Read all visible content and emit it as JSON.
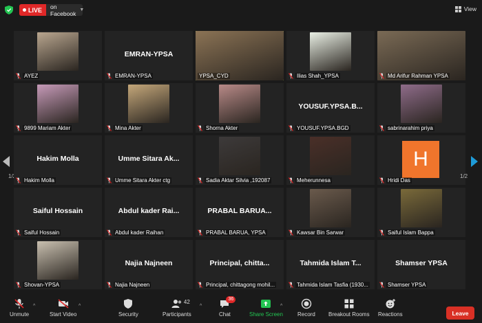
{
  "topbar": {
    "live_label": "LIVE",
    "live_destination": "on Facebook",
    "view_label": "View"
  },
  "gallery": {
    "page_indicator": "1/2",
    "tiles": [
      {
        "center": "",
        "label": "AYEZ",
        "muted": true,
        "kind": "video",
        "tone": "#b9a68f"
      },
      {
        "center": "EMRAN-YPSA",
        "label": "EMRAN-YPSA",
        "muted": true,
        "kind": "name"
      },
      {
        "center": "",
        "label": "YPSA_CYD",
        "muted": false,
        "kind": "wide",
        "tone": "#8b7355",
        "active": true
      },
      {
        "center": "",
        "label": "Ilias Shah_YPSA",
        "muted": true,
        "kind": "video",
        "tone": "#e9efe4"
      },
      {
        "center": "",
        "label": "Md Arifur Rahman YPSA",
        "muted": true,
        "kind": "wide",
        "tone": "#7a6a55"
      },
      {
        "center": "",
        "label": "9899 Mariam Akter",
        "muted": true,
        "kind": "video",
        "tone": "#c69ab8"
      },
      {
        "center": "",
        "label": "Mina Akter",
        "muted": true,
        "kind": "video",
        "tone": "#c4a77a"
      },
      {
        "center": "",
        "label": "Shorna Akter",
        "muted": true,
        "kind": "video",
        "tone": "#b88a88"
      },
      {
        "center": "YOUSUF.YPSA.B...",
        "label": "YOUSUF.YPSA.BGD",
        "muted": true,
        "kind": "name"
      },
      {
        "center": "",
        "label": "sabrinarahim priya",
        "muted": true,
        "kind": "video",
        "tone": "#8f6c8a"
      },
      {
        "center": "Hakim Molla",
        "label": "Hakim Molla",
        "muted": true,
        "kind": "name"
      },
      {
        "center": "Umme Sitara Ak...",
        "label": "Umme Sitara Akter ctg",
        "muted": true,
        "kind": "name"
      },
      {
        "center": "",
        "label": "Sadia Aktar Silvia ,192087",
        "muted": true,
        "kind": "video",
        "tone": "#3d3a3a"
      },
      {
        "center": "",
        "label": "Meherunnesa",
        "muted": true,
        "kind": "video",
        "tone": "#4a2f28"
      },
      {
        "center": "H",
        "label": "Hridi Das",
        "muted": true,
        "kind": "avatar",
        "tone": "#f0752c"
      },
      {
        "center": "Saiful Hossain",
        "label": "Saiful Hossain",
        "muted": true,
        "kind": "name"
      },
      {
        "center": "Abdul kader Rai...",
        "label": "Abdul kader Raihan",
        "muted": true,
        "kind": "name"
      },
      {
        "center": "PRABAL BARUA...",
        "label": "PRABAL BARUA, YPSA",
        "muted": true,
        "kind": "name"
      },
      {
        "center": "",
        "label": "Kawsar Bin Sarwar",
        "muted": true,
        "kind": "video",
        "tone": "#6a5a4c"
      },
      {
        "center": "",
        "label": "Saiful Islam Bappa",
        "muted": true,
        "kind": "video",
        "tone": "#7a6a3a"
      },
      {
        "center": "",
        "label": "Shovan-YPSA",
        "muted": true,
        "kind": "video",
        "tone": "#c9c0b0"
      },
      {
        "center": "Najia Najneen",
        "label": "Najia Najneen",
        "muted": true,
        "kind": "name"
      },
      {
        "center": "Principal,  chitta...",
        "label": "Principal, chittagong mohil...",
        "muted": true,
        "kind": "name"
      },
      {
        "center": "Tahmida Islam T...",
        "label": "Tahmida Islam Tasfia (1930...",
        "muted": true,
        "kind": "name"
      },
      {
        "center": "Shamser YPSA",
        "label": "Shamser YPSA",
        "muted": true,
        "kind": "name"
      }
    ]
  },
  "toolbar": {
    "unmute": "Unmute",
    "start_video": "Start Video",
    "security": "Security",
    "participants": "Participants",
    "participants_count": "42",
    "chat": "Chat",
    "chat_badge": "36",
    "share_screen": "Share Screen",
    "record": "Record",
    "breakout_rooms": "Breakout Rooms",
    "reactions": "Reactions",
    "leave": "Leave"
  },
  "colors": {
    "live_red": "#e02828",
    "active_speaker": "#b4de4a",
    "share_green": "#23c552",
    "leave_red": "#d93025",
    "nav_blue": "#1e9bd8"
  }
}
